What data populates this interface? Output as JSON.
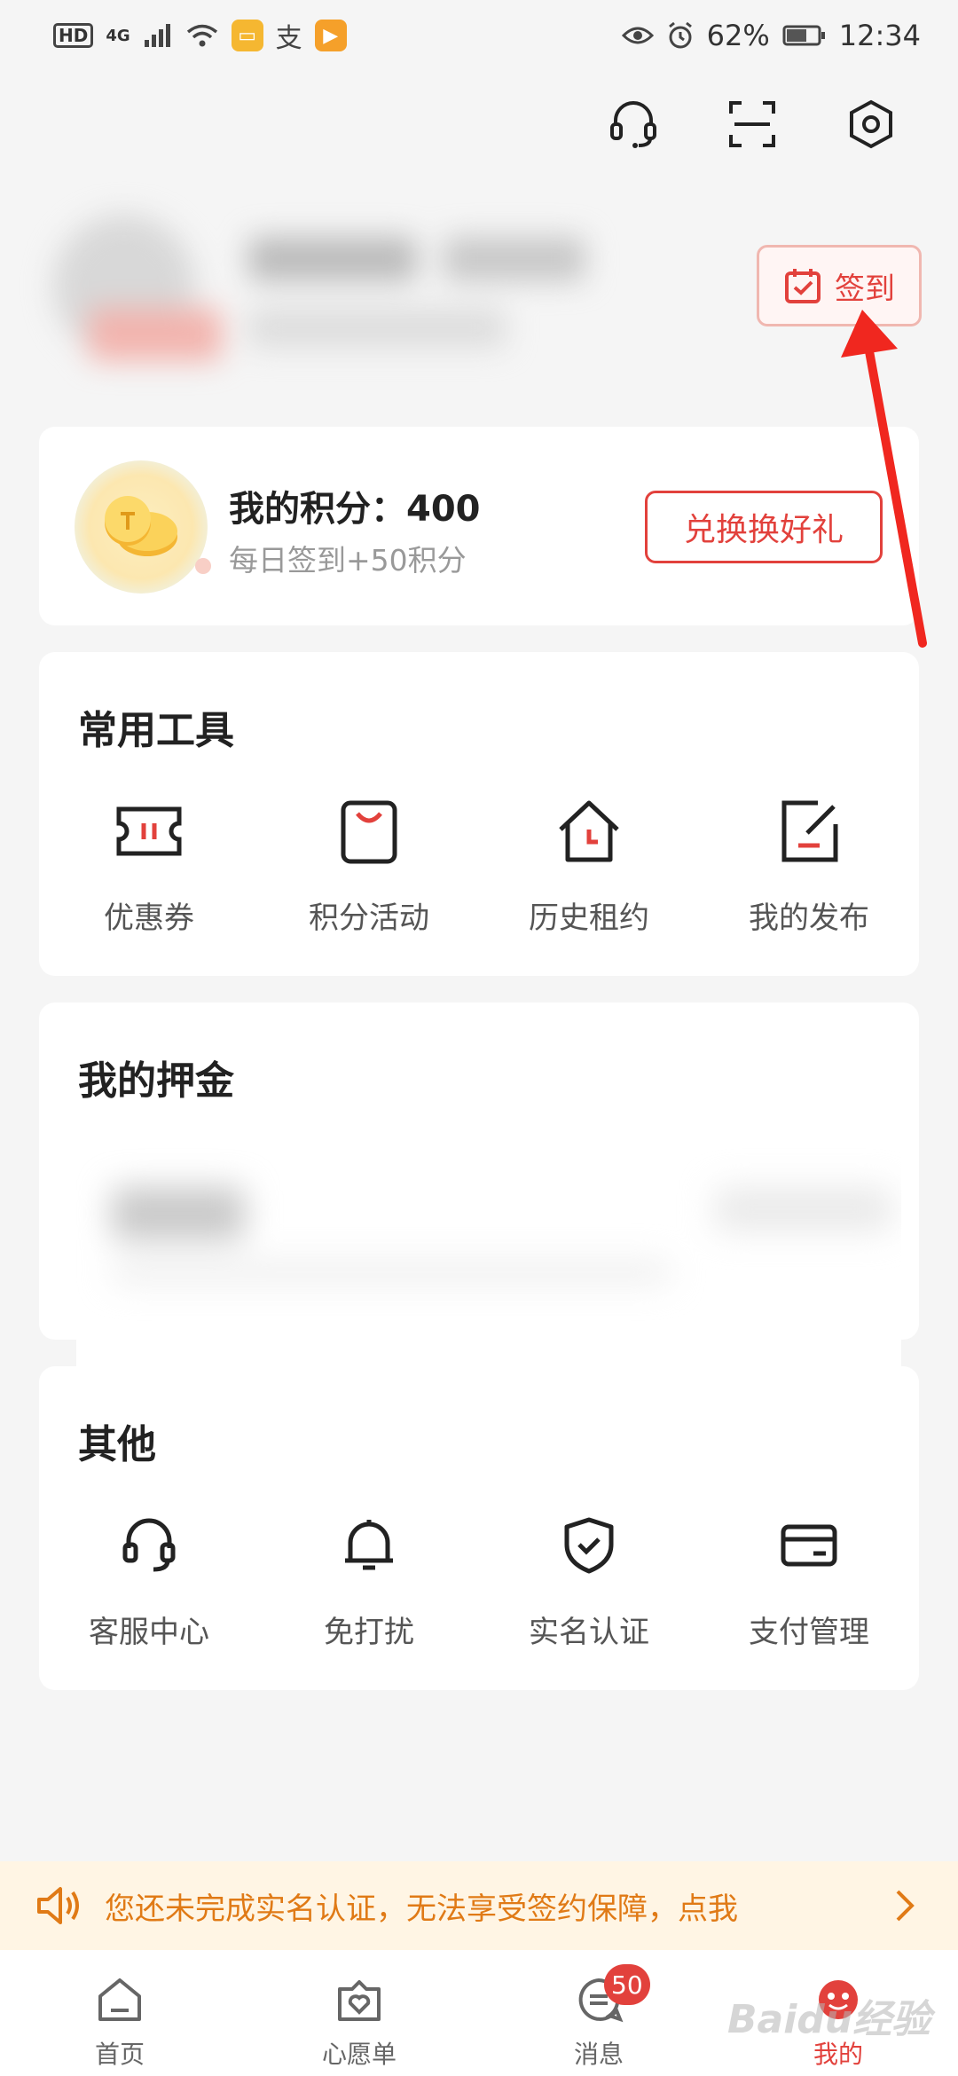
{
  "status_bar": {
    "left_badges": [
      "HD",
      "4G"
    ],
    "right_battery": "62%",
    "time": "12:34"
  },
  "header_icons": [
    "headset-icon",
    "scan-icon",
    "settings-hexagon-icon"
  ],
  "signin": {
    "label": "签到"
  },
  "points": {
    "title": "我的积分：400",
    "subtitle": "每日签到+50积分",
    "redeem_label": "兑换换好礼"
  },
  "tools": {
    "title": "常用工具",
    "items": [
      {
        "label": "优惠券",
        "icon": "coupon-icon"
      },
      {
        "label": "积分活动",
        "icon": "shopping-bag-icon"
      },
      {
        "label": "历史租约",
        "icon": "house-clock-icon"
      },
      {
        "label": "我的发布",
        "icon": "edit-icon"
      }
    ]
  },
  "deposit": {
    "title": "我的押金"
  },
  "other": {
    "title": "其他",
    "items": [
      {
        "label": "客服中心",
        "icon": "headset-icon"
      },
      {
        "label": "免打扰",
        "icon": "bell-icon"
      },
      {
        "label": "实名认证",
        "icon": "shield-check-icon"
      },
      {
        "label": "支付管理",
        "icon": "card-icon"
      }
    ]
  },
  "notice": {
    "text": "您还未完成实名认证，无法享受签约保障，点我"
  },
  "bottom_nav": {
    "items": [
      {
        "label": "首页"
      },
      {
        "label": "心愿单"
      },
      {
        "label": "消息",
        "badge": "50"
      },
      {
        "label": "我的"
      }
    ]
  },
  "colors": {
    "accent": "#e2413c",
    "notice_text": "#e07a16",
    "background": "#f5f5f5"
  },
  "watermark": "Baidu经验"
}
